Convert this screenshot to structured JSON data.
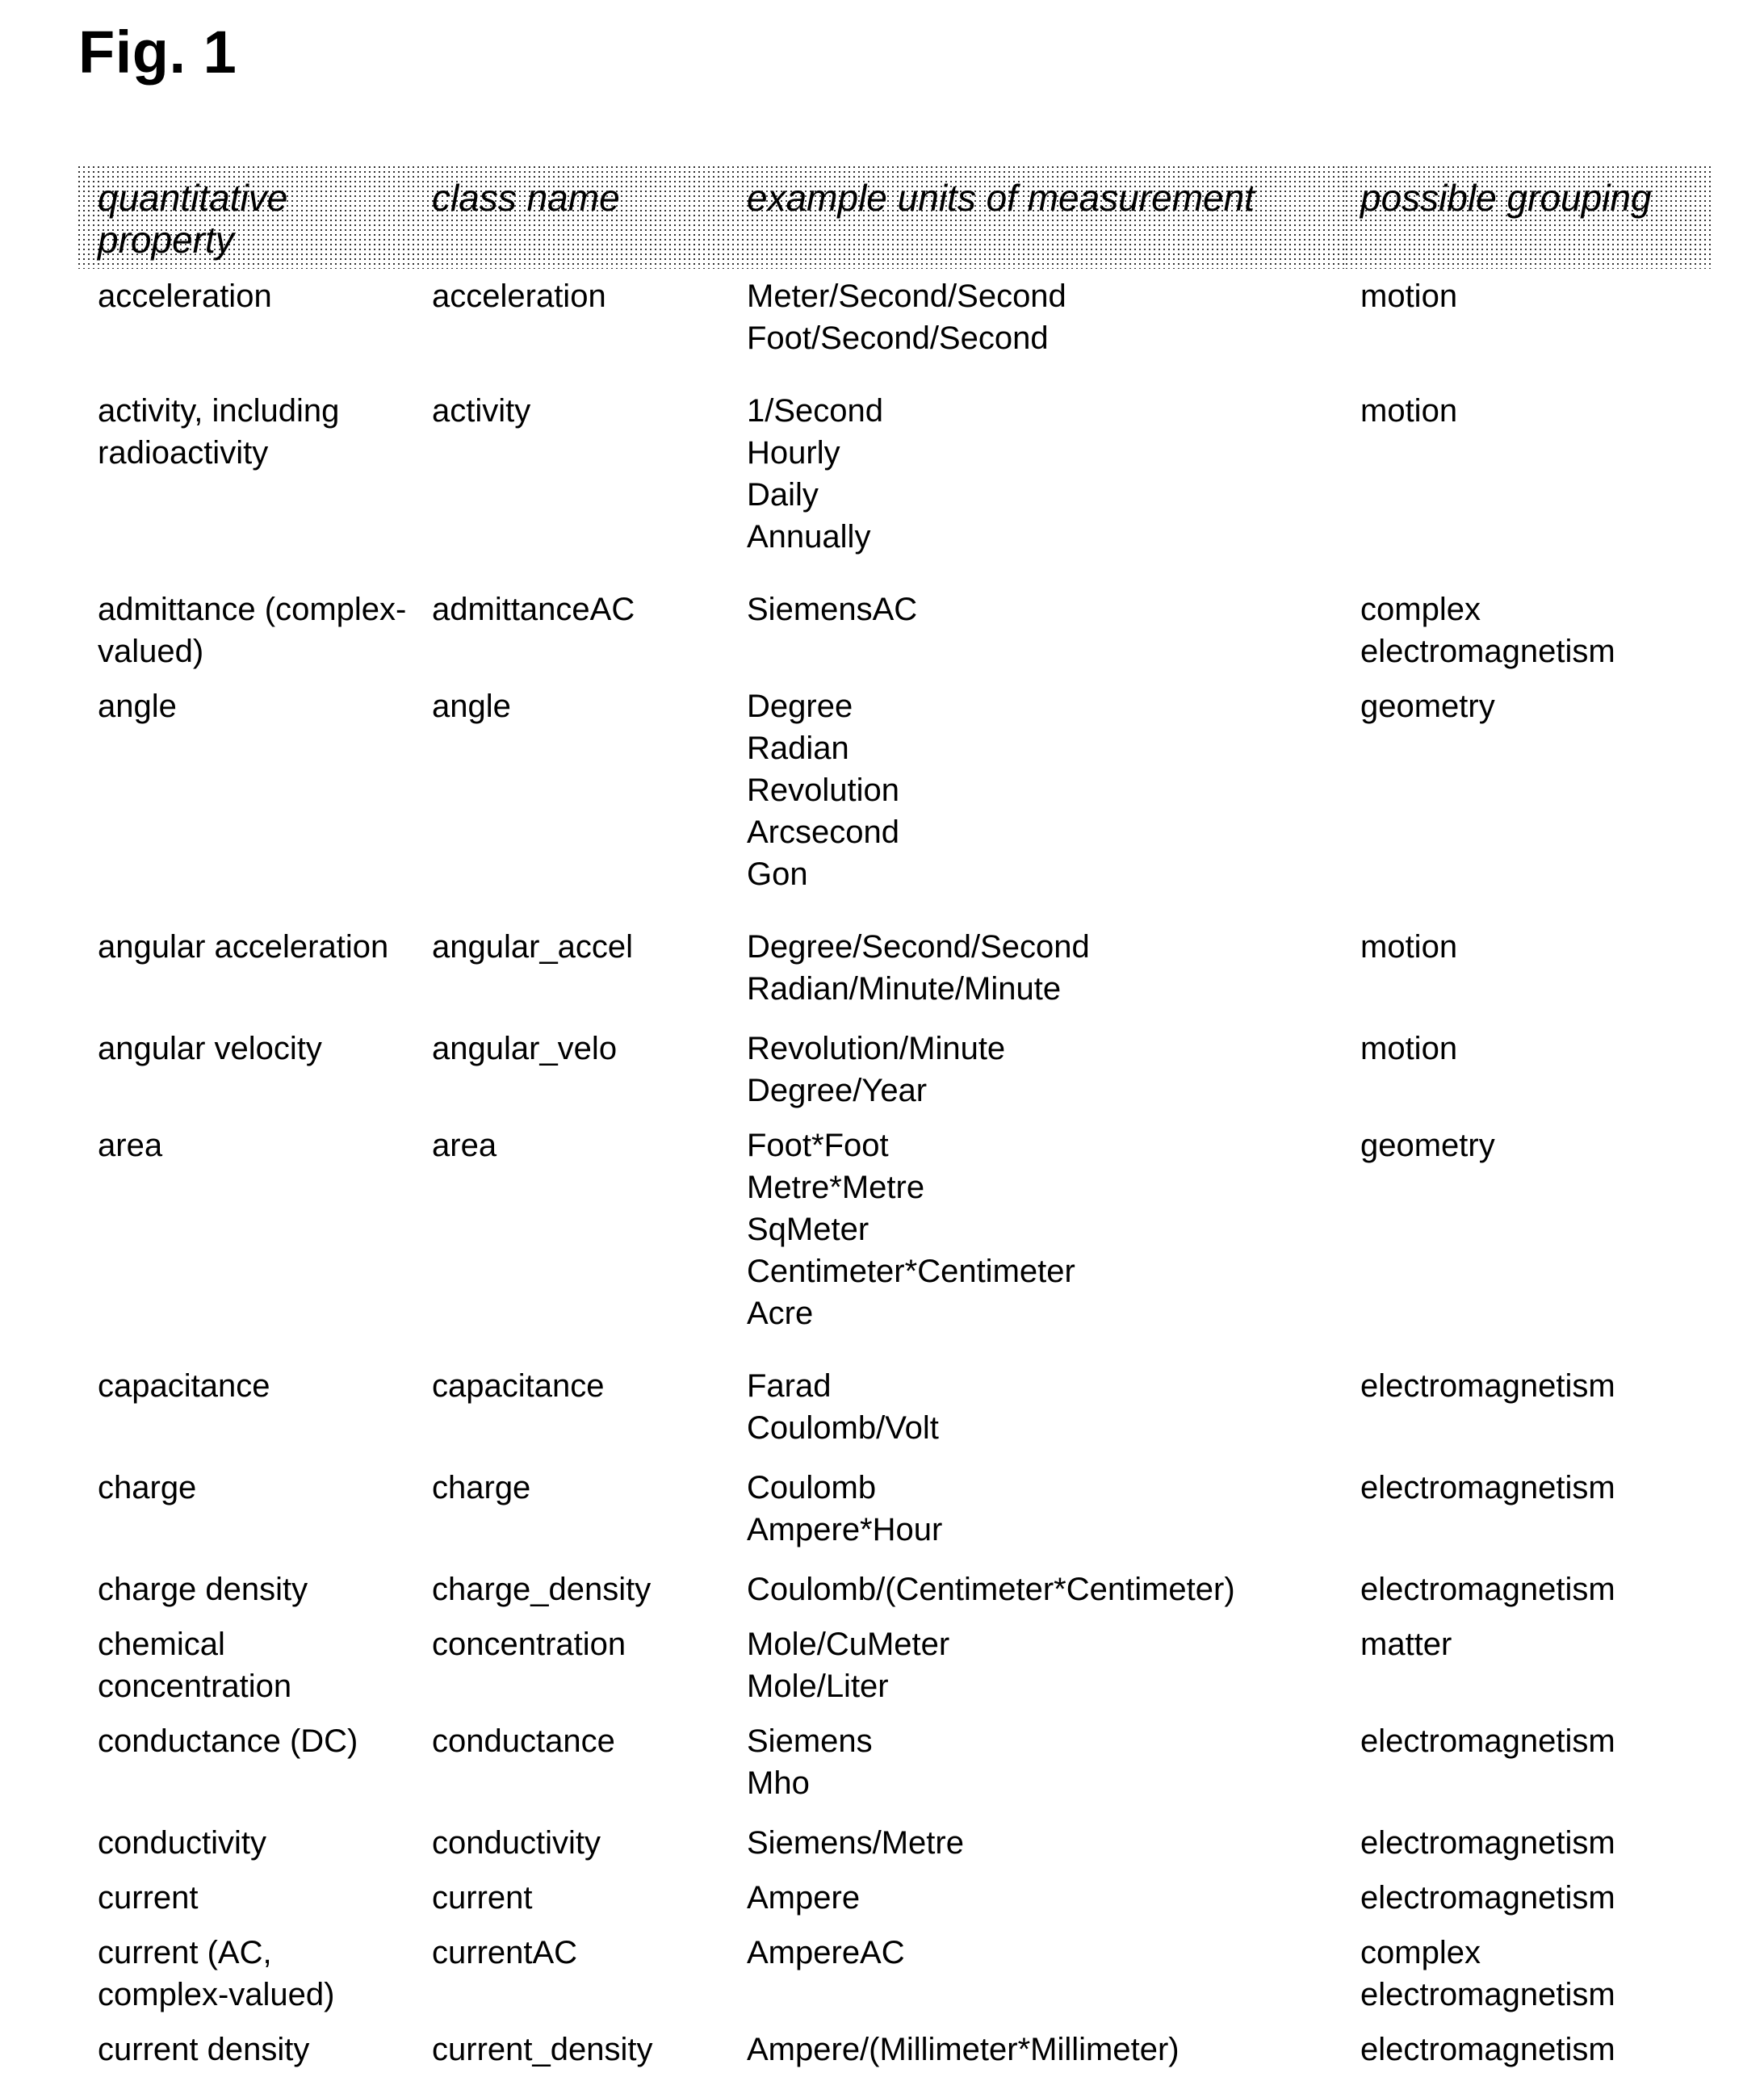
{
  "figure": {
    "title": "Fig. 1"
  },
  "table": {
    "headers": [
      "quantitative property",
      "class name",
      "example units of measurement",
      "possible grouping"
    ],
    "rows": [
      {
        "property": "acceleration",
        "class_name": "acceleration",
        "units": "Meter/Second/Second\nFoot/Second/Second",
        "grouping": "motion",
        "gap_after": 22
      },
      {
        "property": "activity, including radioactivity",
        "class_name": "activity",
        "units": "1/Second\nHourly\nDaily\nAnnually",
        "grouping": "motion",
        "gap_after": 22
      },
      {
        "property": "admittance (complex-valued)",
        "class_name": "admittanceAC",
        "units": "SiemensAC",
        "grouping": "complex electromagnetism",
        "gap_after": 0
      },
      {
        "property": "angle",
        "class_name": "angle",
        "units": "Degree\nRadian\nRevolution\nArcsecond\nGon",
        "grouping": "geometry",
        "gap_after": 22
      },
      {
        "property": "angular acceleration",
        "class_name": "angular_accel",
        "units": "Degree/Second/Second\nRadian/Minute/Minute",
        "grouping": "motion",
        "gap_after": 6
      },
      {
        "property": "angular velocity",
        "class_name": "angular_velo",
        "units": "Revolution/Minute\nDegree/Year",
        "grouping": "motion",
        "gap_after": 0
      },
      {
        "property": "area",
        "class_name": "area",
        "units": "Foot*Foot\nMetre*Metre\nSqMeter\nCentimeter*Centimeter\nAcre",
        "grouping": "geometry",
        "gap_after": 22
      },
      {
        "property": "capacitance",
        "class_name": "capacitance",
        "units": "Farad\nCoulomb/Volt",
        "grouping": "electromagnetism",
        "gap_after": 6
      },
      {
        "property": "charge",
        "class_name": "charge",
        "units": "Coulomb\nAmpere*Hour",
        "grouping": "electromagnetism",
        "gap_after": 6
      },
      {
        "property": "charge density",
        "class_name": "charge_density",
        "units": "Coulomb/(Centimeter*Centimeter)",
        "grouping": "electromagnetism",
        "gap_after": 0
      },
      {
        "property": "chemical concentration",
        "class_name": "concentration",
        "units": "Mole/CuMeter\nMole/Liter",
        "grouping": "matter",
        "gap_after": 0
      },
      {
        "property": "conductance (DC)",
        "class_name": "conductance",
        "units": "Siemens\nMho",
        "grouping": "electromagnetism",
        "gap_after": 6
      },
      {
        "property": "conductivity",
        "class_name": "conductivity",
        "units": "Siemens/Metre",
        "grouping": "electromagnetism",
        "gap_after": 0
      },
      {
        "property": "current",
        "class_name": "current",
        "units": "Ampere",
        "grouping": "electromagnetism",
        "gap_after": 0
      },
      {
        "property": "current (AC, complex-valued)",
        "class_name": "currentAC",
        "units": "AmpereAC",
        "grouping": "complex electromagnetism",
        "gap_after": 0
      },
      {
        "property": "current density",
        "class_name": "current_density",
        "units": "Ampere/(Millimeter*Millimeter)",
        "grouping": "electromagnetism",
        "gap_after": 0
      }
    ]
  }
}
